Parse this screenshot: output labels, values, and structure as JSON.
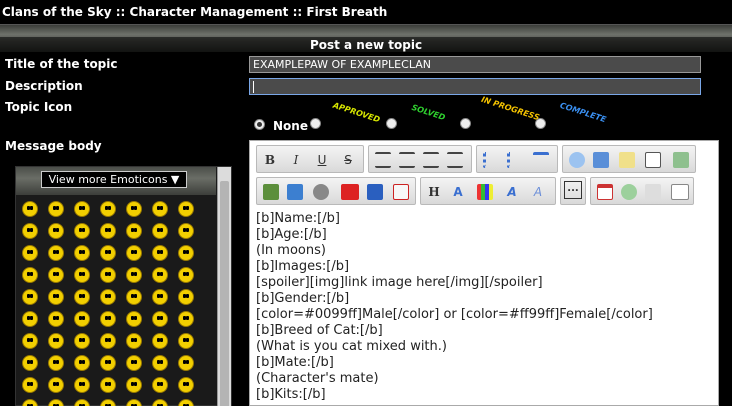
{
  "breadcrumb": {
    "forum": "Clans of the Sky",
    "separator1": " :: ",
    "section": "Character Management",
    "separator2": " :: ",
    "subforum": "First Breath"
  },
  "header": {
    "title": "Post a new topic"
  },
  "form": {
    "title_label": "Title of the topic",
    "title_value": "EXAMPLEPAW OF EXAMPLECLAN",
    "description_label": "Description",
    "description_value": "",
    "icon_label": "Topic Icon",
    "icon_none": "None",
    "icons": [
      "APPROVED",
      "SOLVED",
      "IN PROGRESS",
      "COMPLETE"
    ],
    "message_label": "Message body"
  },
  "emoticons": {
    "more_label": "View more Emoticons ▼"
  },
  "toolbar": {
    "bold": "B",
    "italic": "I",
    "underline": "U",
    "strike": "S",
    "heading": "H",
    "font_a": "A",
    "more": "..."
  },
  "message": {
    "lines": [
      "[b]Name:[/b]",
      "[b]Age:[/b]",
      "(In moons)",
      "[b]Images:[/b]",
      "[spoiler][img]link image here[/img][/spoiler]",
      "[b]Gender:[/b]",
      "[color=#0099ff]Male[/color] or [color=#ff99ff]Female[/color]",
      "[b]Breed of Cat:[/b]",
      "(What is you cat mixed with.)",
      "[b]Mate:[/b]",
      "(Character's mate)",
      "[b]Kits:[/b]"
    ]
  },
  "colors": {
    "approved": "#d7e600",
    "solved": "#2fd12f",
    "in_progress": "#f4c200",
    "complete": "#3a8ff0"
  }
}
